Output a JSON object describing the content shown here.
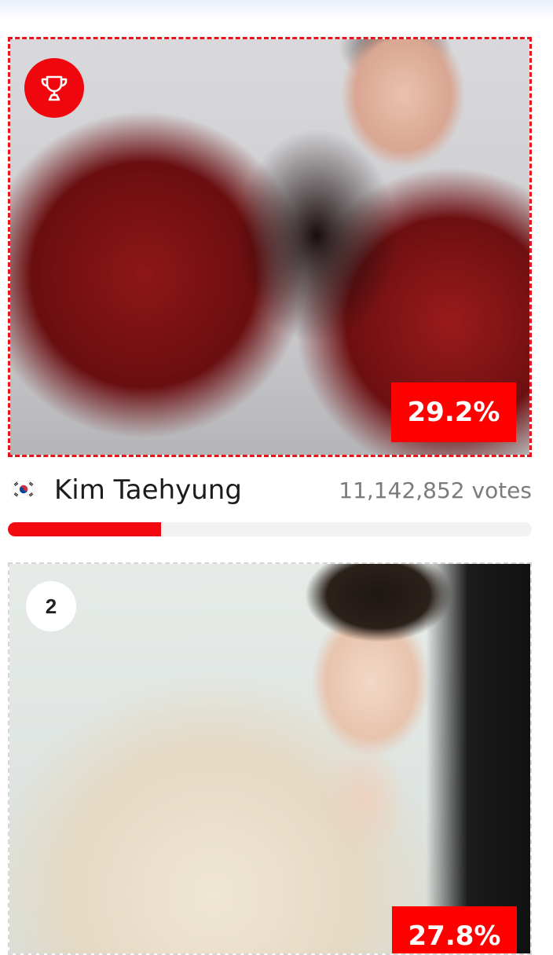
{
  "entries": [
    {
      "rank": 1,
      "percent_text": "29.2%",
      "name": "Kim Taehyung",
      "country_flag": "south-korea-flag",
      "votes_text": "11,142,852 votes",
      "progress": 0.292,
      "badge_icon": "trophy-icon",
      "accent_color": "#f0070d"
    },
    {
      "rank": 2,
      "rank_label": "2",
      "percent_text": "27.8%",
      "accent_color": "#ff0000"
    }
  ]
}
